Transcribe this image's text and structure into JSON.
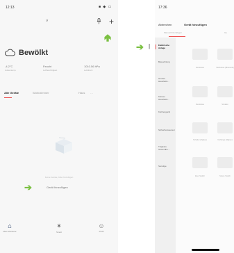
{
  "left": {
    "status_time": "12:13",
    "status_icons": "■ ◆ ▭",
    "chevron": "˅",
    "mic_icon": "🎙",
    "plus_icon": "+",
    "weather_title": "Bewölkt",
    "weather": [
      {
        "value": "-4.2°C",
        "label": "Außentemp."
      },
      {
        "value": "Feucht",
        "label": "Luftfeuchtigkeit"
      },
      {
        "value": "1010.56 hPa",
        "label": "Luftdruck"
      }
    ],
    "tabs": [
      "Alle Geräte",
      "Wohnzimmer",
      "Haus",
      "…"
    ],
    "empty_text": "Keine Geräte, bitte hinzufügen",
    "add_button": "Gerät hinzufügen",
    "nav": [
      {
        "icon": "⌂",
        "label": "Mein Zuhause"
      },
      {
        "icon": "✶",
        "label": "Smart"
      },
      {
        "icon": "☺",
        "label": "Profil"
      }
    ]
  },
  "right": {
    "status_time": "17:36",
    "cancel": "Abbrechen",
    "title": "Gerät hinzufügen",
    "tabs": [
      "Manuell hinzufügen",
      "Ge"
    ],
    "categories": [
      "Elektrische Anlage",
      "Beleuchtung",
      "Großes Haushalts…",
      "Kleines Haushalts…",
      "Küchengerät",
      "Sicherheitssensor",
      "Tragbare Gesundhe…",
      "Sonstige"
    ],
    "devices": [
      {
        "label": "Steckdose"
      },
      {
        "label": "Steckdose (Bluetooth)"
      },
      {
        "label": "Steckdose"
      },
      {
        "label": "Schalter"
      },
      {
        "label": "Schalter (Zigbee)"
      },
      {
        "label": "Vorhänge (Zigbee)"
      },
      {
        "label": "Ener Switch"
      },
      {
        "label": "Szene Switch"
      }
    ]
  },
  "colors": {
    "accent": "#7bc042",
    "tab_underline": "#e55555"
  }
}
